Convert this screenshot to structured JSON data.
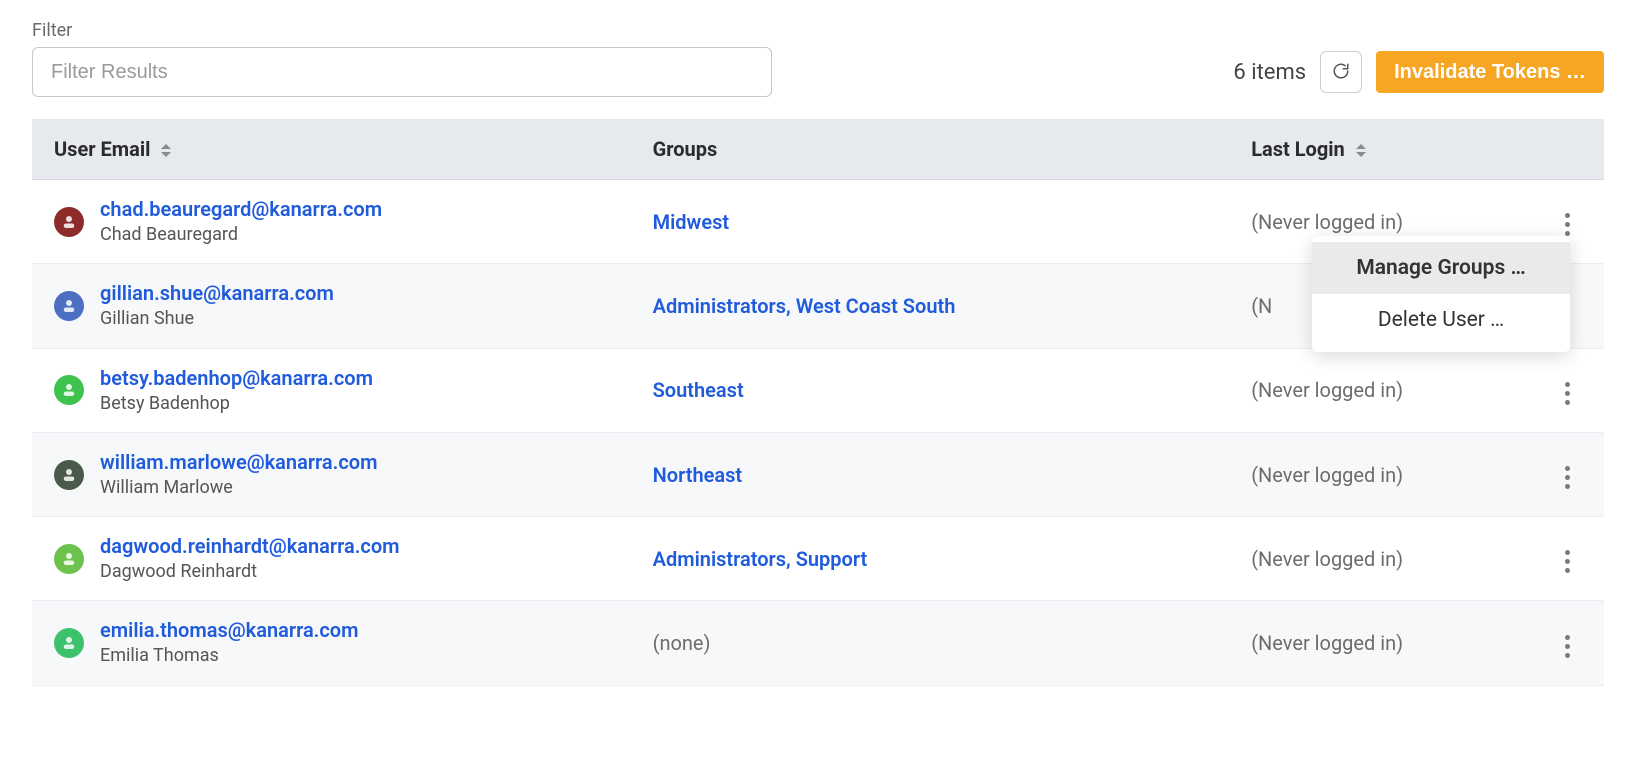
{
  "filter": {
    "label": "Filter",
    "placeholder": "Filter Results",
    "value": ""
  },
  "toolbar": {
    "items_count_text": "6 items",
    "invalidate_label": "Invalidate Tokens …"
  },
  "table": {
    "headers": {
      "user_email": "User Email",
      "groups": "Groups",
      "last_login": "Last Login"
    },
    "none_groups_text": "(none)"
  },
  "users": [
    {
      "email": "chad.beauregard@kanarra.com",
      "name": "Chad Beauregard",
      "avatar_color": "#8e2b2b",
      "groups": [
        "Midwest"
      ],
      "last_login": "(Never logged in)",
      "menu_open": false
    },
    {
      "email": "gillian.shue@kanarra.com",
      "name": "Gillian Shue",
      "avatar_color": "#4d6fc2",
      "groups": [
        "Administrators",
        "West Coast South"
      ],
      "last_login": "(N",
      "menu_open": true
    },
    {
      "email": "betsy.badenhop@kanarra.com",
      "name": "Betsy Badenhop",
      "avatar_color": "#3cc24d",
      "groups": [
        "Southeast"
      ],
      "last_login": "(Never logged in)",
      "menu_open": false
    },
    {
      "email": "william.marlowe@kanarra.com",
      "name": "William Marlowe",
      "avatar_color": "#4a5a4a",
      "groups": [
        "Northeast"
      ],
      "last_login": "(Never logged in)",
      "menu_open": false
    },
    {
      "email": "dagwood.reinhardt@kanarra.com",
      "name": "Dagwood Reinhardt",
      "avatar_color": "#6dc24d",
      "groups": [
        "Administrators",
        "Support"
      ],
      "last_login": "(Never logged in)",
      "menu_open": false
    },
    {
      "email": "emilia.thomas@kanarra.com",
      "name": "Emilia Thomas",
      "avatar_color": "#3cc26d",
      "groups": [],
      "last_login": "(Never logged in)",
      "menu_open": false
    }
  ],
  "row_menu": {
    "manage_groups": "Manage Groups …",
    "delete_user": "Delete User …"
  }
}
